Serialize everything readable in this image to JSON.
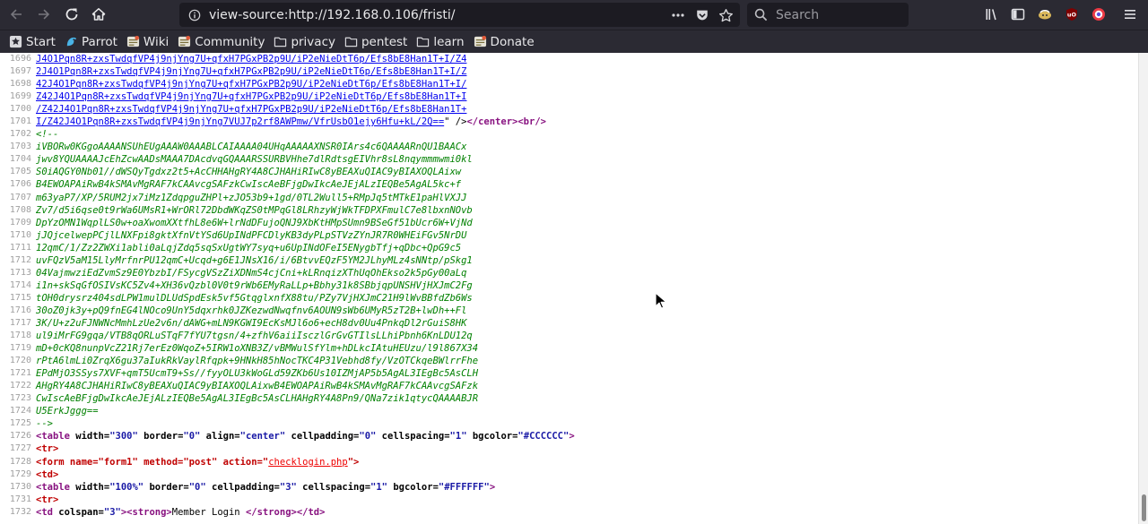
{
  "browser": {
    "url": "view-source:http://192.168.0.106/fristi/",
    "search_placeholder": "Search",
    "icons": [
      "back-arrow-icon",
      "forward-arrow-icon",
      "reload-icon",
      "home-icon",
      "info-icon",
      "page-actions-icon",
      "pocket-icon",
      "bookmark-star-icon",
      "search-icon",
      "library-icon",
      "sidebar-icon",
      "extension-icon",
      "ublock-icon",
      "privacy-badger-icon",
      "menu-icon"
    ]
  },
  "bookmarks": [
    {
      "label": "Start",
      "icon": "star-page-icon"
    },
    {
      "label": "Parrot",
      "icon": "parrot-icon"
    },
    {
      "label": "Wiki",
      "icon": "wiki-icon"
    },
    {
      "label": "Community",
      "icon": "community-icon"
    },
    {
      "label": "privacy",
      "icon": "folder-icon"
    },
    {
      "label": "pentest",
      "icon": "folder-icon"
    },
    {
      "label": "learn",
      "icon": "folder-icon"
    },
    {
      "label": "Donate",
      "icon": "donate-icon"
    }
  ],
  "source": {
    "lines": [
      {
        "n": "1696",
        "kind": "link",
        "text": "J4O1Pqn8R+zxsTwdqfVP4j9njYng7U+qfxH7PGxPB2p9U/iP2eNieDtT6p/Efs8bE8Han1T+I/Z4"
      },
      {
        "n": "1697",
        "kind": "link",
        "text": "2J4O1Pqn8R+zxsTwdqfVP4j9njYng7U+qfxH7PGxPB2p9U/iP2eNieDtT6p/Efs8bE8Han1T+I/Z"
      },
      {
        "n": "1698",
        "kind": "link",
        "text": "42J4O1Pqn8R+zxsTwdqfVP4j9njYng7U+qfxH7PGxPB2p9U/iP2eNieDtT6p/Efs8bE8Han1T+I/"
      },
      {
        "n": "1699",
        "kind": "link",
        "text": "Z42J4O1Pqn8R+zxsTwdqfVP4j9njYng7U+qfxH7PGxPB2p9U/iP2eNieDtT6p/Efs8bE8Han1T+I"
      },
      {
        "n": "1700",
        "kind": "link",
        "text": "/Z42J4O1Pqn8R+zxsTwdqfVP4j9njYng7U+qfxH7PGxPB2p9U/iP2eNieDtT6p/Efs8bE8Han1T+"
      },
      {
        "n": "1701",
        "kind": "linkend",
        "text": "I/Z42J4O1Pqn8R+zxsTwdqfVP4j9njYng7VUJ7p2rf8AWPmw/VfrUsbO1ejy6Hfu+kL/2Q==",
        "after_q": "\" />",
        "tag1": "</center>",
        "tag2": "<br/>"
      },
      {
        "n": "1702",
        "kind": "comment",
        "text": "<!--"
      },
      {
        "n": "1703",
        "kind": "comment",
        "text": "iVBORw0KGgoAAAANSUhEUgAAAW0AAABLCAIAAAA04UHqAAAAAXNSR0IArs4c6QAAAARnQU1BAACx"
      },
      {
        "n": "1704",
        "kind": "comment",
        "text": "jwv8YQUAAAAJcEhZcwAADsMAAA7DAcdvqGQAAARSSURBVHhe7dlRdtsgEIVhr8sL8nqymmmwmi0kl"
      },
      {
        "n": "1705",
        "kind": "comment",
        "text": "S0iAQGY0Nb01//dWSQyTgdxz2t5+AcCHHAHgRY4A8CJHAHiRIwC8yBEAXuQIAC9yBIAXOQLAixw"
      },
      {
        "n": "1706",
        "kind": "comment",
        "text": "B4EWOAPAiRwB4kSMAvMgRAF7kCAAvcgSAFzkCwIscAeBFjgDwIkcAeJEjALzIEQBe5AgAL5kc+f"
      },
      {
        "n": "1707",
        "kind": "comment",
        "text": "m63yaP7/XP/5RUM2jx7iMz1ZdqpguZHPl+zJO53b9+1gd/0TL2Wull5+RMpJq5tMTkE1paHlVXJJ"
      },
      {
        "n": "1708",
        "kind": "comment",
        "text": "Zv7/d5i6qse0t9rWa6UMsR1+WrORl72DbdWKqZS0tMPqGl8LRhzyWjWkTFDPXFmulC7e8lbxnNOvb"
      },
      {
        "n": "1709",
        "kind": "comment",
        "text": "DpYzOMN1WqplLS0w+oaXwomXXtfhL8e6W+lrNdDFujoQNJ9XbKtHMpSUmn9BSeGf51bUcr6W+VjNd"
      },
      {
        "n": "1710",
        "kind": "comment",
        "text": "jJQjcelwepPCjlLNXFpi8gktXfnVtYSd6UpINdPFCDlyKB3dyPLpSTVzZYnJR7R0WHEiFGv5NrDU"
      },
      {
        "n": "1711",
        "kind": "comment",
        "text": "12qmC/1/Zz2ZWXi1abli0aLqjZdq5sqSxUgtWY7syq+u6UpINdOFeI5ENygbTfj+qDbc+QpG9c5"
      },
      {
        "n": "1712",
        "kind": "comment",
        "text": "uvFQzV5aM15LlyMrfnrPU12qmC+Ucqd+g6E1JNsX16/i/6BtvvEQzF5YM2JLhyMLz4sNNtp/pSkg1"
      },
      {
        "n": "1713",
        "kind": "comment",
        "text": "04VajmwziEdZvmSz9E0YbzbI/FSycgVSzZiXDNmS4cjCni+kLRnqizXThUqOhEkso2k5pGy00aLq"
      },
      {
        "n": "1714",
        "kind": "comment",
        "text": "i1n+skSqGfOSIVsKC5Zv4+XH36vQzbl0V0t9rWb6EMyRaLLp+Bbhy31k8SBbjqpUNSHVjHXJmC2Fg"
      },
      {
        "n": "1715",
        "kind": "comment",
        "text": "tOH0drysrz404sdLPW1mulDLUdSpdEsk5vf5GtqglxnfX88tu/PZy7VjHXJmC21H9lWvBBfdZb6Ws"
      },
      {
        "n": "1716",
        "kind": "comment",
        "text": "30oZ0jk3y+pQ9fnEG4lNOco9UnY5dqxrhk0JZKezwdNwqfnv6AOUN9sWb6UMyR5zT2B+lwDh++Fl"
      },
      {
        "n": "1717",
        "kind": "comment",
        "text": "3K/U+z2uFJNWNcMmhLzUe2v6n/dAWG+mLN9KGWI9EcKsMJl6o6+ecH8dv0Uu4PnkqDl2rGuiS8HK"
      },
      {
        "n": "1718",
        "kind": "comment",
        "text": "ul9iMrFG9gqa/VTB8qORLuSTqF7fYU7tgsn/4+zfhV6aiiIsczlGrGvGTIlsLLhiPbnh6KnLDU12q"
      },
      {
        "n": "1719",
        "kind": "comment",
        "text": "mD+0cKQ8nunpVcZ21Rj7erEz0WqoZ+5IRW1oXNB3Z/vBMWulSfYlm+hDLkcIAtuHEUzu/l9l867X34"
      },
      {
        "n": "1720",
        "kind": "comment",
        "text": "rPtA6lmLi0ZrqX6gu37aIukRkVaylRfqpk+9HNkH85hNocTKC4P31Vebhd8fy/VzOTCkqeBWlrrFhe"
      },
      {
        "n": "1721",
        "kind": "comment",
        "text": "EPdMjO3SSys7XVF+qmT5UcmT9+Ss//fyyOLU3kWoGLd59ZKb6Us10IZMjAP5b5AgAL3IEgBc5AsCLH"
      },
      {
        "n": "1722",
        "kind": "comment",
        "text": "AHgRY4A8CJHAHiRIwC8yBEAXuQIAC9yBIAXOQLAixwB4EWOAPAiRwB4kSMAvMgRAF7kCAAvcgSAFzk"
      },
      {
        "n": "1723",
        "kind": "comment",
        "text": "CwIscAeBFjgDwIkcAeJEjALzIEQBe5AgAL3IEgBc5AsCLHAHgRY4A8Pn9/QNa7zik1qtycQAAAABJR"
      },
      {
        "n": "1724",
        "kind": "comment",
        "text": "U5ErkJggg=="
      },
      {
        "n": "1725",
        "kind": "comment",
        "text": "-->"
      },
      {
        "n": "1726",
        "kind": "tagline",
        "parts": [
          [
            "tag",
            "<table "
          ],
          [
            "attr",
            "width="
          ],
          [
            "val",
            "\"300\""
          ],
          [
            "attr",
            " border="
          ],
          [
            "val",
            "\"0\""
          ],
          [
            "attr",
            " align="
          ],
          [
            "val",
            "\"center\""
          ],
          [
            "attr",
            " cellpadding="
          ],
          [
            "val",
            "\"0\""
          ],
          [
            "attr",
            " cellspacing="
          ],
          [
            "val",
            "\"1\""
          ],
          [
            "attr",
            " bgcolor="
          ],
          [
            "val",
            "\"#CCCCCC\""
          ],
          [
            "tag",
            ">"
          ]
        ]
      },
      {
        "n": "1727",
        "kind": "tagline",
        "parts": [
          [
            "tag-red",
            "<tr>"
          ]
        ]
      },
      {
        "n": "1728",
        "kind": "tagline",
        "parts": [
          [
            "tag-red",
            "<form name=\"form1\" method=\"post\" action=\""
          ],
          [
            "red-link",
            "checklogin.php"
          ],
          [
            "tag-red",
            "\">"
          ]
        ]
      },
      {
        "n": "1729",
        "kind": "tagline",
        "parts": [
          [
            "tag-red",
            "<td>"
          ]
        ]
      },
      {
        "n": "1730",
        "kind": "tagline",
        "parts": [
          [
            "tag",
            "<table "
          ],
          [
            "attr",
            "width="
          ],
          [
            "val",
            "\"100%\""
          ],
          [
            "attr",
            " border="
          ],
          [
            "val",
            "\"0\""
          ],
          [
            "attr",
            " cellpadding="
          ],
          [
            "val",
            "\"3\""
          ],
          [
            "attr",
            " cellspacing="
          ],
          [
            "val",
            "\"1\""
          ],
          [
            "attr",
            " bgcolor="
          ],
          [
            "val",
            "\"#FFFFFF\""
          ],
          [
            "tag",
            ">"
          ]
        ]
      },
      {
        "n": "1731",
        "kind": "tagline",
        "parts": [
          [
            "tag-red",
            "<tr>"
          ]
        ]
      },
      {
        "n": "1732",
        "kind": "tagline",
        "parts": [
          [
            "tag",
            "<td "
          ],
          [
            "attr",
            "colspan="
          ],
          [
            "val",
            "\"3\""
          ],
          [
            "tag",
            ">"
          ],
          [
            "tag",
            "<strong>"
          ],
          [
            "plain",
            "Member Login "
          ],
          [
            "tag",
            "</strong>"
          ],
          [
            "tag",
            "</td>"
          ]
        ]
      }
    ]
  },
  "colors": {
    "toolbar_bg": "#2b2a33",
    "urlbar_bg": "#1c1b22",
    "link": "#0000ee",
    "comment": "#008000",
    "tag": "#881280",
    "attr_value": "#1a1aa6"
  }
}
